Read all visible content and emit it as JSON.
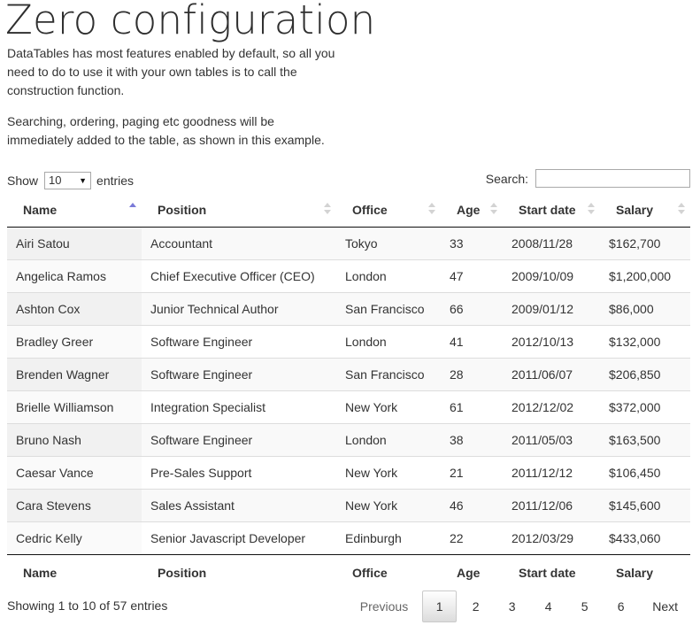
{
  "page": {
    "title": "Zero configuration",
    "intro": [
      "DataTables has most features enabled by default, so all you need to do to use it with your own tables is to call the construction function.",
      "Searching, ordering, paging etc goodness will be immediately added to the table, as shown in this example."
    ]
  },
  "controls": {
    "show_label": "Show",
    "length_value": "10",
    "entries_label": "entries",
    "search_label": "Search:",
    "search_value": "",
    "search_placeholder": ""
  },
  "table": {
    "columns": [
      "Name",
      "Position",
      "Office",
      "Age",
      "Start date",
      "Salary"
    ],
    "sort": {
      "column": "Name",
      "direction": "ascending"
    },
    "rows": [
      [
        "Airi Satou",
        "Accountant",
        "Tokyo",
        "33",
        "2008/11/28",
        "$162,700"
      ],
      [
        "Angelica Ramos",
        "Chief Executive Officer (CEO)",
        "London",
        "47",
        "2009/10/09",
        "$1,200,000"
      ],
      [
        "Ashton Cox",
        "Junior Technical Author",
        "San Francisco",
        "66",
        "2009/01/12",
        "$86,000"
      ],
      [
        "Bradley Greer",
        "Software Engineer",
        "London",
        "41",
        "2012/10/13",
        "$132,000"
      ],
      [
        "Brenden Wagner",
        "Software Engineer",
        "San Francisco",
        "28",
        "2011/06/07",
        "$206,850"
      ],
      [
        "Brielle Williamson",
        "Integration Specialist",
        "New York",
        "61",
        "2012/12/02",
        "$372,000"
      ],
      [
        "Bruno Nash",
        "Software Engineer",
        "London",
        "38",
        "2011/05/03",
        "$163,500"
      ],
      [
        "Caesar Vance",
        "Pre-Sales Support",
        "New York",
        "21",
        "2011/12/12",
        "$106,450"
      ],
      [
        "Cara Stevens",
        "Sales Assistant",
        "New York",
        "46",
        "2011/12/06",
        "$145,600"
      ],
      [
        "Cedric Kelly",
        "Senior Javascript Developer",
        "Edinburgh",
        "22",
        "2012/03/29",
        "$433,060"
      ]
    ]
  },
  "footer": {
    "info": "Showing 1 to 10 of 57 entries",
    "pagination": {
      "previous": "Previous",
      "pages": [
        "1",
        "2",
        "3",
        "4",
        "5",
        "6"
      ],
      "current": "1",
      "next": "Next"
    }
  },
  "colors": {
    "sort_active": "#7a7ad8",
    "sort_inactive": "#d3d3d3",
    "row_stripe": "#f9f9f9",
    "sorted_column": "#f1f1f1"
  }
}
